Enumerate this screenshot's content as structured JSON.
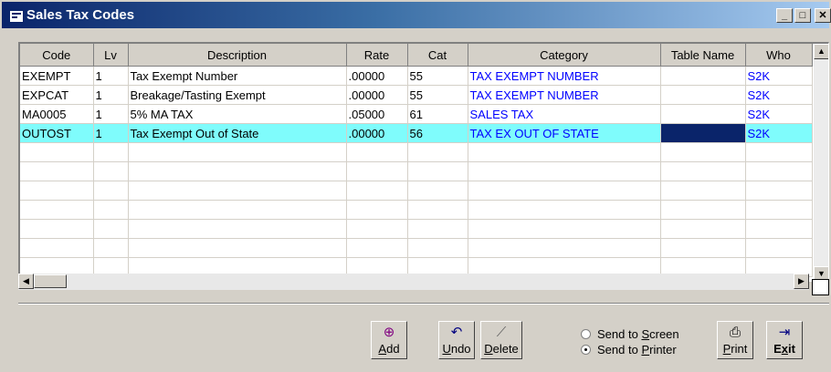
{
  "window": {
    "title": "Sales Tax Codes",
    "controls": {
      "minimize": "_",
      "maximize": "□",
      "close": "✕"
    }
  },
  "table": {
    "columns": [
      "Code",
      "Lv",
      "Description",
      "Rate",
      "Cat",
      "Category",
      "Table Name",
      "Who"
    ],
    "rows": [
      [
        "EXEMPT",
        "1",
        "Tax Exempt Number",
        ".00000",
        "55",
        "TAX EXEMPT NUMBER",
        "",
        "S2K"
      ],
      [
        "EXPCAT",
        "1",
        "Breakage/Tasting Exempt",
        ".00000",
        "55",
        "TAX EXEMPT NUMBER",
        "",
        "S2K"
      ],
      [
        "MA0005",
        "1",
        "5% MA TAX",
        ".05000",
        "61",
        "SALES TAX",
        "",
        "S2K"
      ],
      [
        "OUTOST",
        "1",
        "Tax Exempt Out of State",
        ".00000",
        "56",
        "TAX EX OUT OF STATE",
        "",
        "S2K"
      ]
    ],
    "selected_row": 3,
    "empty_rows": 7
  },
  "buttons": {
    "add": {
      "label_u": "A",
      "label_rest": "dd",
      "icon": "add-record-icon"
    },
    "undo": {
      "label_u": "U",
      "label_rest": "ndo",
      "icon": "undo-icon"
    },
    "delete": {
      "label_u": "D",
      "label_rest": "elete",
      "icon": "delete-icon"
    },
    "print": {
      "label_u": "P",
      "label_rest": "rint",
      "icon": "printer-icon"
    },
    "exit": {
      "label_pre": "E",
      "label_u": "x",
      "label_rest": "it",
      "icon": "exit-icon"
    }
  },
  "output": {
    "screen": {
      "pre": "Send to ",
      "u": "S",
      "rest": "creen",
      "selected": false
    },
    "printer": {
      "pre": "Send to ",
      "u": "P",
      "rest": "rinter",
      "selected": true
    }
  },
  "colors": {
    "title_bar": "#0a246a",
    "selection": "#7ffcfc",
    "link_text": "#0000ff"
  }
}
